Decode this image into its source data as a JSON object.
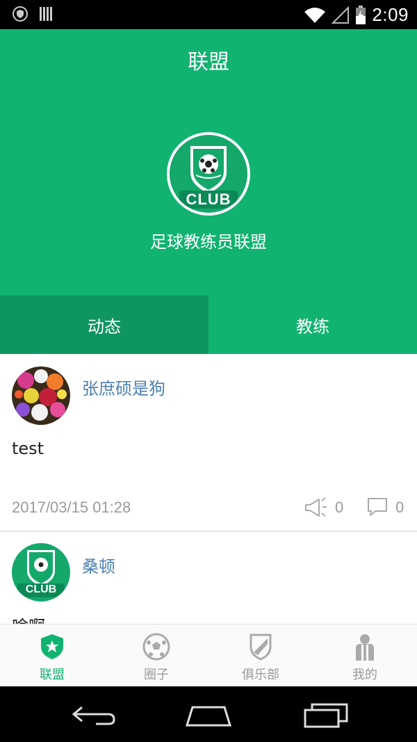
{
  "status_bar": {
    "time": "2:09"
  },
  "header": {
    "title": "联盟",
    "club_name": "足球教练员联盟",
    "logo_text": "CLUB"
  },
  "tabs": [
    {
      "label": "动态",
      "active": true
    },
    {
      "label": "教练",
      "active": false
    }
  ],
  "posts": [
    {
      "username": "张庶硕是狗",
      "content": "test",
      "time": "2017/03/15 01:28",
      "likes": "0",
      "comments": "0",
      "avatar": "flowers-avatar"
    },
    {
      "username": "桑顿",
      "content": "啥啊",
      "avatar": "club-logo-avatar",
      "avatar_text": "CLUB"
    }
  ],
  "bottom_nav": [
    {
      "label": "联盟",
      "icon": "shield-star-icon",
      "active": true
    },
    {
      "label": "圈子",
      "icon": "soccer-ball-icon",
      "active": false
    },
    {
      "label": "俱乐部",
      "icon": "club-shield-icon",
      "active": false
    },
    {
      "label": "我的",
      "icon": "player-icon",
      "active": false
    }
  ],
  "colors": {
    "primary": "#10b36f",
    "tab_active": "#0f9660",
    "username": "#4a7fb5",
    "meta": "#9a9a9a"
  }
}
